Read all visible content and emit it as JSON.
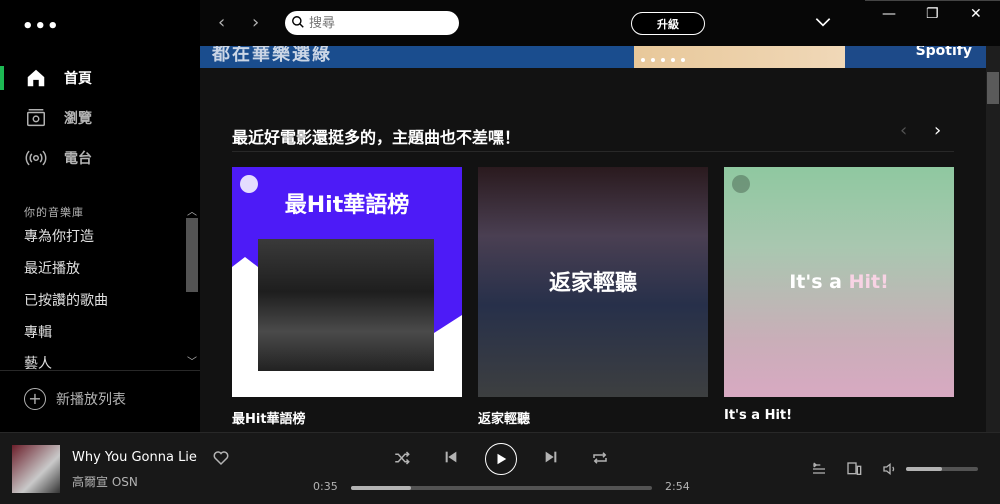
{
  "sidebar": {
    "menu_dots": "•••",
    "nav": [
      {
        "label": "首頁",
        "active": true
      },
      {
        "label": "瀏覽",
        "active": false
      },
      {
        "label": "電台",
        "active": false
      }
    ],
    "library_title": "你的音樂庫",
    "library": [
      "專為你打造",
      "最近播放",
      "已按讚的歌曲",
      "專輯",
      "藝人"
    ],
    "new_playlist": "新播放列表"
  },
  "topbar": {
    "back": "‹",
    "forward": "›",
    "search_placeholder": "搜尋",
    "upgrade": "升級",
    "minimize": "—",
    "restore": "❐",
    "close": "✕"
  },
  "banner": {
    "text": "都在華樂選綠",
    "brand": "Spotify"
  },
  "section": {
    "title": "最近好電影還挺多的，主題曲也不差嘿！",
    "cards": [
      {
        "title": "最Hit華語榜",
        "label": "最Hit華語榜"
      },
      {
        "title": "返家輕聽",
        "label": "返家輕聽"
      },
      {
        "title_a": "It's a ",
        "title_b": "Hit!",
        "label": "It's a Hit!"
      }
    ]
  },
  "player": {
    "track": "Why You Gonna Lie",
    "artist": "高爾宣 OSN",
    "elapsed": "0:35",
    "duration": "2:54",
    "progress": 0.2,
    "volume": 0.5
  },
  "colors": {
    "accent": "#1db954",
    "background": "#121212",
    "sidebar": "#000000",
    "player": "#181818"
  }
}
